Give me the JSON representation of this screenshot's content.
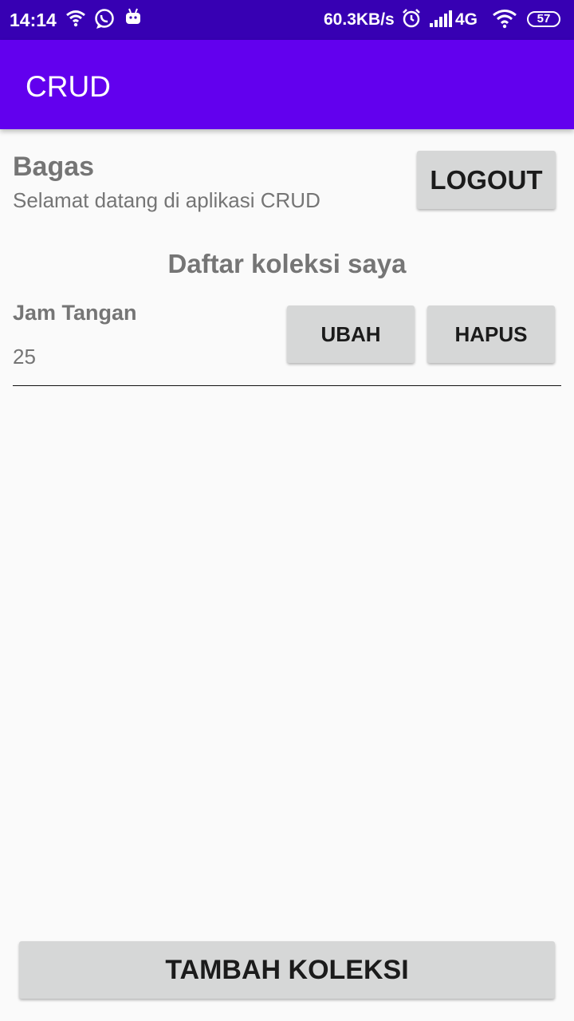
{
  "status_bar": {
    "time": "14:14",
    "net_speed": "60.3KB/s",
    "network": "4G",
    "battery": "57",
    "icons": [
      "wifi-icon",
      "whatsapp-icon",
      "android-icon",
      "alarm-icon",
      "signal-icon",
      "wifi-icon"
    ]
  },
  "app_bar": {
    "title": "CRUD"
  },
  "user": {
    "name": "Bagas",
    "welcome": "Selamat datang di aplikasi CRUD",
    "logout_label": "LOGOUT"
  },
  "list": {
    "title": "Daftar koleksi saya",
    "items": [
      {
        "name": "Jam Tangan",
        "quantity": "25",
        "edit_label": "UBAH",
        "delete_label": "HAPUS"
      }
    ]
  },
  "footer": {
    "add_label": "TAMBAH KOLEKSI"
  },
  "colors": {
    "status_bar": "#3700b3",
    "app_bar": "#6200ee",
    "background": "#fafafa",
    "button": "#d6d7d7",
    "text_gray": "#757575"
  }
}
